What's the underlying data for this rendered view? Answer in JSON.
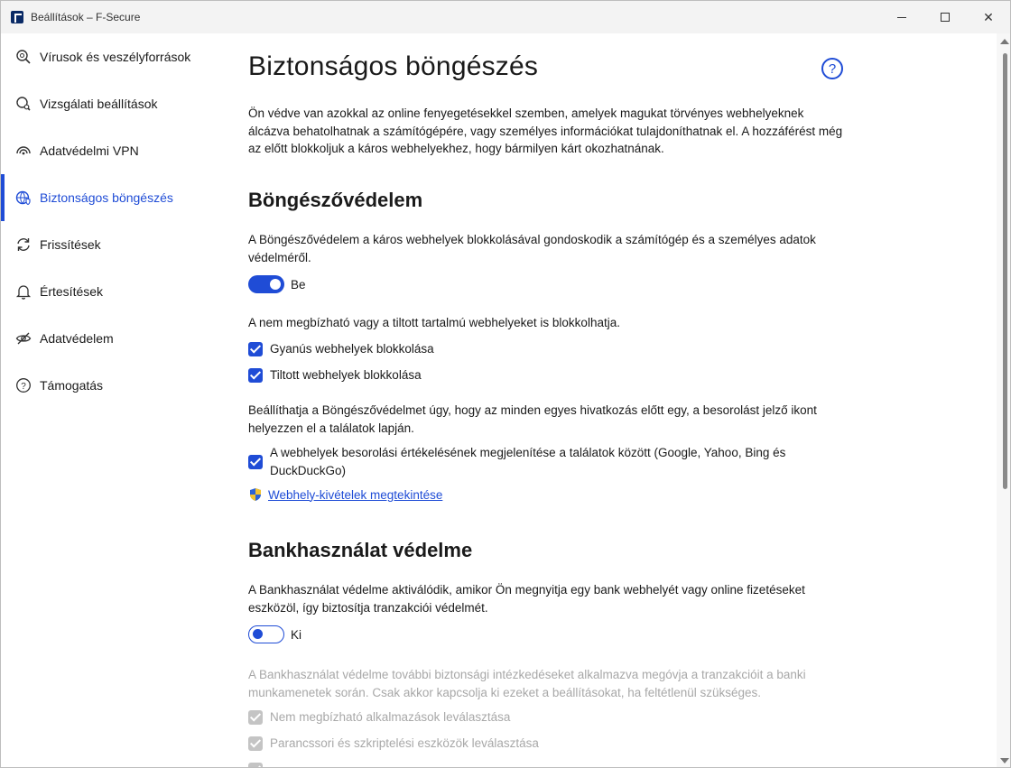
{
  "window": {
    "title": "Beállítások – F-Secure",
    "minimize": "—",
    "maximize": "☐",
    "close": "✕"
  },
  "sidebar": {
    "items": [
      {
        "label": "Vírusok és veszélyforrások",
        "icon": "virus-search-icon"
      },
      {
        "label": "Vizsgálati beállítások",
        "icon": "scan-settings-icon"
      },
      {
        "label": "Adatvédelmi VPN",
        "icon": "vpn-icon"
      },
      {
        "label": "Biztonságos böngészés",
        "icon": "globe-shield-icon"
      },
      {
        "label": "Frissítések",
        "icon": "refresh-icon"
      },
      {
        "label": "Értesítések",
        "icon": "bell-icon"
      },
      {
        "label": "Adatvédelem",
        "icon": "eye-slash-icon"
      },
      {
        "label": "Támogatás",
        "icon": "help-circle-icon"
      }
    ],
    "active_index": 3
  },
  "main": {
    "title": "Biztonságos böngészés",
    "help": "?",
    "intro": "Ön védve van azokkal az online fenyegetésekkel szemben, amelyek magukat törvényes webhelyeknek álcázva behatolhatnak a számítógépére, vagy személyes információkat tulajdoníthatnak el. A hozzáférést még az előtt blokkoljuk a káros webhelyekhez, hogy bármilyen kárt okozhatnának.",
    "browser_protection": {
      "title": "Böngészővédelem",
      "description": "A Böngészővédelem a káros webhelyek blokkolásával gondoskodik a számítógép és a személyes adatok védelméről.",
      "toggle_label": "Be",
      "toggle_on": true,
      "block_note": "A nem megbízható vagy a tiltott tartalmú webhelyeket is blokkolhatja.",
      "check_suspicious": "Gyanús webhelyek blokkolása",
      "check_prohibited": "Tiltott webhelyek blokkolása",
      "rating_note": "Beállíthatja a Böngészővédelmet úgy, hogy az minden egyes hivatkozás előtt egy, a besorolást jelző ikont helyezzen el a találatok lapján.",
      "check_ratings": "A webhelyek besorolási értékelésének megjelenítése a találatok között (Google, Yahoo, Bing és DuckDuckGo)",
      "exceptions_link": "Webhely-kivételek megtekintése"
    },
    "banking_protection": {
      "title": "Bankhasználat védelme",
      "description": "A Bankhasználat védelme aktiválódik, amikor Ön megnyitja egy bank webhelyét vagy online fizetéseket eszközöl, így biztosítja tranzakciói védelmét.",
      "toggle_label": "Ki",
      "toggle_on": false,
      "extra_note": "A Bankhasználat védelme további biztonsági intézkedéseket alkalmazva megóvja a tranzakcióit a banki munkamenetek során. Csak akkor kapcsolja ki ezeket a beállításokat, ha feltétlenül szükséges.",
      "check_untrusted_apps": "Nem megbízható alkalmazások leválasztása",
      "check_cmd_tools": "Parancssori és szkriptelési eszközök leválasztása"
    }
  },
  "colors": {
    "accent": "#1f4cd6",
    "disabled": "#a8a8a8"
  }
}
